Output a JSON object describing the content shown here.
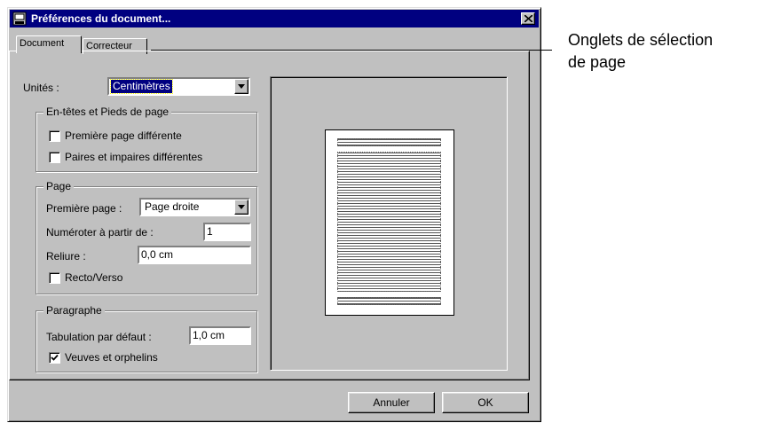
{
  "window": {
    "title": "Préférences du document...",
    "icon": "document-app-icon"
  },
  "tabs": [
    {
      "label": "Document",
      "active": true
    },
    {
      "label": "Correcteur",
      "active": false
    }
  ],
  "units": {
    "label": "Unités :",
    "value": "Centimètres"
  },
  "headers_footers": {
    "legend": "En-têtes et Pieds de page",
    "first_page": {
      "label": "Première page différente",
      "checked": false
    },
    "odd_even": {
      "label": "Paires et impaires différentes",
      "checked": false
    }
  },
  "page_group": {
    "legend": "Page",
    "first_page_label": "Première page :",
    "first_page_value": "Page droite",
    "number_from_label": "Numéroter à partir de :",
    "number_from_value": "1",
    "binding_label": "Reliure :",
    "binding_value": "0,0 cm",
    "recto_verso": {
      "label": "Recto/Verso",
      "checked": false
    }
  },
  "paragraph": {
    "legend": "Paragraphe",
    "tab_label": "Tabulation par défaut :",
    "tab_value": "1,0 cm",
    "widows": {
      "label": "Veuves et orphelins",
      "checked": true
    }
  },
  "buttons": {
    "cancel": "Annuler",
    "ok": "OK"
  },
  "annotation": {
    "line1": "Onglets de sélection",
    "line2": "de page"
  },
  "colors": {
    "dialog_face": "#c0c0c0",
    "titlebar": "#000080",
    "selection": "#000080"
  }
}
